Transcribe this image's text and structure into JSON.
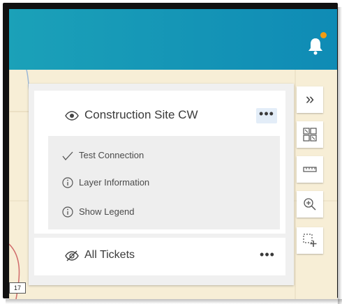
{
  "header": {
    "notification_icon": "bell-icon",
    "notification_badge_color": "#f39c12",
    "bar_color_start": "#1ba1b8",
    "bar_color_end": "#0f8bb5"
  },
  "map": {
    "highway_label": "17"
  },
  "layers": [
    {
      "name": "Construction Site CW",
      "visibility_icon": "eye-icon",
      "more_label": "•••",
      "expanded": true,
      "menu": [
        {
          "label": "Test Connection",
          "icon": "checkmark-icon"
        },
        {
          "label": "Layer Information",
          "icon": "info-icon"
        },
        {
          "label": "Show Legend",
          "icon": "info-icon"
        }
      ]
    },
    {
      "name": "All Tickets",
      "visibility_icon": "eye-slash-icon",
      "more_label": "•••",
      "expanded": false
    }
  ],
  "toolbar": {
    "collapse_label": "»",
    "tools": [
      "collapse-panel-icon",
      "basemap-gallery-icon",
      "measure-icon",
      "zoom-in-icon",
      "select-area-icon"
    ]
  }
}
